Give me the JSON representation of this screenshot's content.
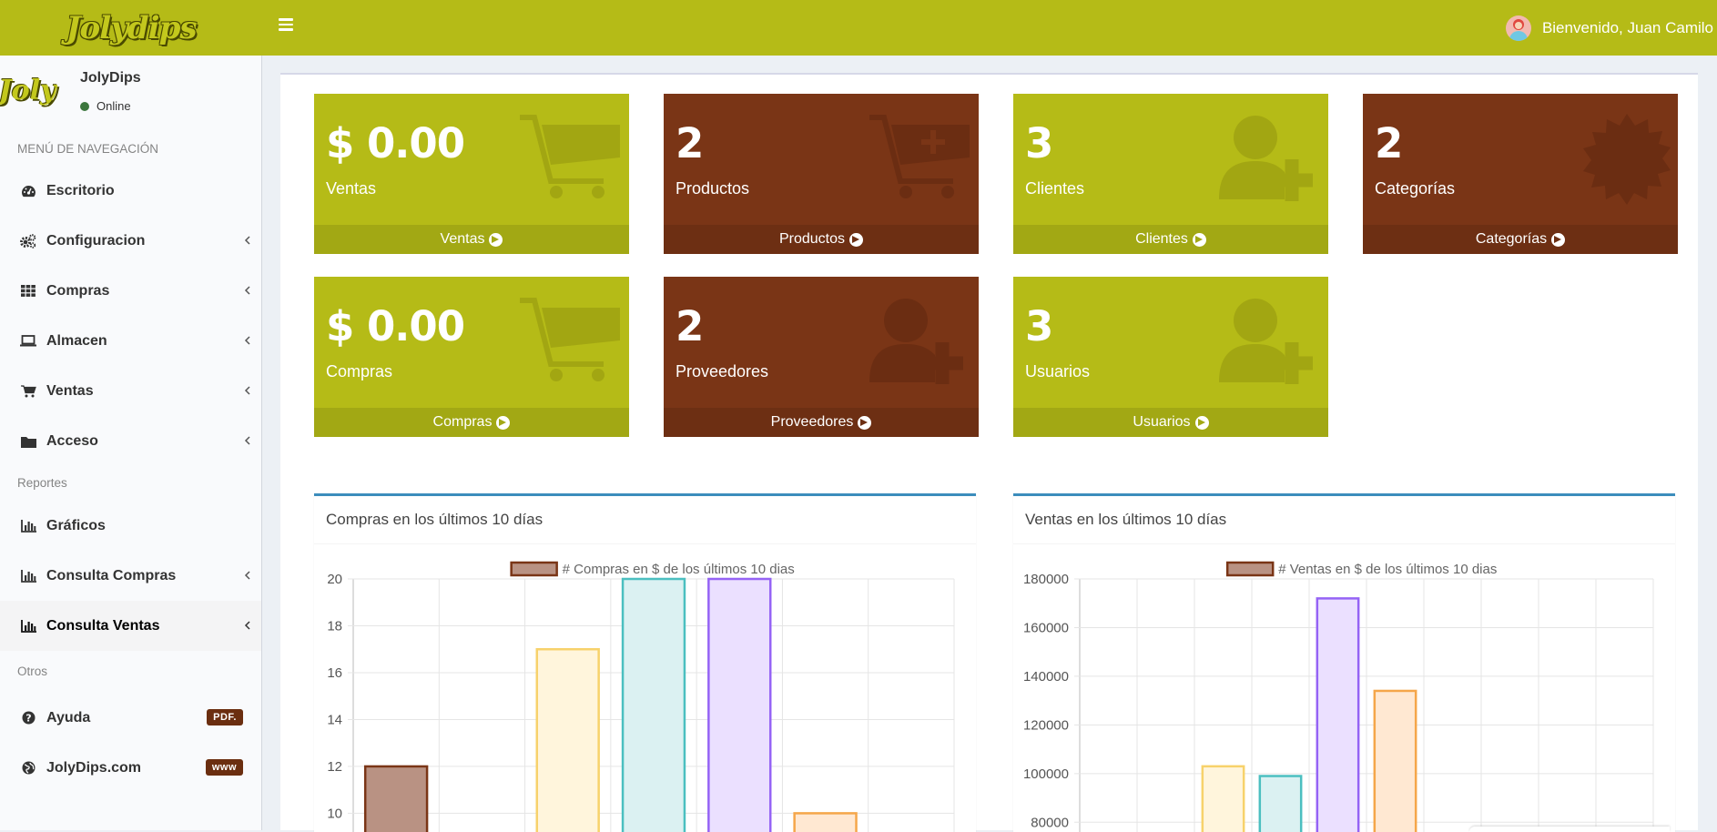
{
  "header": {
    "logo_text": "Jolydips",
    "user_greeting": "Bienvenido, Juan Camilo",
    "colors": {
      "topbar": "#b5bb17"
    }
  },
  "sidebar": {
    "profile": {
      "avatar_text": "Joly",
      "name": "JolyDips",
      "status": "Online"
    },
    "nav_header": "MENÚ DE NAVEGACIÓN",
    "items": [
      {
        "label": "Escritorio",
        "icon": "dashboard-icon"
      },
      {
        "label": "Configuracion",
        "icon": "cogs-icon"
      },
      {
        "label": "Compras",
        "icon": "grid-icon"
      },
      {
        "label": "Almacen",
        "icon": "laptop-icon"
      },
      {
        "label": "Ventas",
        "icon": "cart-icon"
      },
      {
        "label": "Acceso",
        "icon": "folder-icon"
      }
    ],
    "reportes_header": "Reportes",
    "reportes": [
      {
        "label": "Gráficos",
        "icon": "bar-chart-icon"
      },
      {
        "label": "Consulta Compras",
        "icon": "bar-chart-icon"
      },
      {
        "label": "Consulta Ventas",
        "icon": "bar-chart-icon"
      }
    ],
    "otros_header": "Otros",
    "otros": [
      {
        "label": "Ayuda",
        "icon": "question-icon",
        "badge": "PDF."
      },
      {
        "label": "JolyDips.com",
        "icon": "globe-icon",
        "badge": "www"
      }
    ]
  },
  "boxes": [
    {
      "value": "$ 0.00",
      "label": "Ventas",
      "footer": "Ventas",
      "color": "#b5bb17",
      "icon": "cart-icon"
    },
    {
      "value": "2",
      "label": "Productos",
      "footer": "Productos",
      "color": "#7a3516",
      "icon": "cart-plus-icon"
    },
    {
      "value": "3",
      "label": "Clientes",
      "footer": "Clientes",
      "color": "#b5bb17",
      "icon": "user-plus-icon"
    },
    {
      "value": "2",
      "label": "Categorías",
      "footer": "Categorías",
      "color": "#7a3516",
      "icon": "certificate-icon"
    },
    {
      "value": "$ 0.00",
      "label": "Compras",
      "footer": "Compras",
      "color": "#b5bb17",
      "icon": "cart-icon"
    },
    {
      "value": "2",
      "label": "Proveedores",
      "footer": "Proveedores",
      "color": "#7a3516",
      "icon": "user-plus-icon"
    },
    {
      "value": "3",
      "label": "Usuarios",
      "footer": "Usuarios",
      "color": "#b5bb17",
      "icon": "user-plus-icon"
    }
  ],
  "chart_data": [
    {
      "type": "bar",
      "title": "Compras en los últimos 10 días",
      "legend": "# Compras en $ de los últimos 10 dias",
      "legend_position": "top",
      "grid": true,
      "y_ticks": [
        20,
        18,
        16,
        14,
        12,
        10
      ],
      "visible_ylim": [
        9.2,
        20
      ],
      "values": [
        12,
        null,
        17,
        20,
        20,
        10,
        null
      ],
      "colors": [
        "#b99283",
        null,
        "#fff5dc",
        "#dbf1f2",
        "#ebe0ff",
        "#ffe8d2",
        null
      ],
      "border_colors": [
        "#7a3516",
        null,
        "#f7d26b",
        "#4bbfc0",
        "#9563f5",
        "#f5a64a",
        null
      ]
    },
    {
      "type": "bar",
      "title": "Ventas en los últimos 10 días",
      "legend": "# Ventas en $ de los últimos 10 dias",
      "legend_position": "top",
      "grid": true,
      "y_ticks": [
        180000,
        160000,
        140000,
        120000,
        100000,
        80000
      ],
      "visible_ylim": [
        76000,
        180000
      ],
      "values": [
        null,
        null,
        103000,
        99000,
        172000,
        134000,
        null,
        null,
        null,
        null
      ],
      "colors": [
        null,
        null,
        "#fff5dc",
        "#dbf1f2",
        "#ebe0ff",
        "#ffe8d2",
        null,
        null,
        null,
        null
      ],
      "border_colors": [
        null,
        null,
        "#f7d26b",
        "#4bbfc0",
        "#9563f5",
        "#f5a64a",
        null,
        null,
        null,
        null
      ]
    }
  ]
}
